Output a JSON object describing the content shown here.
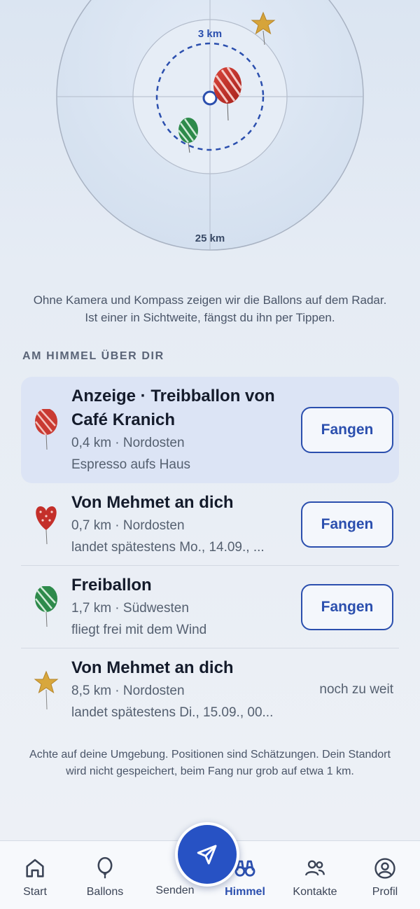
{
  "radar": {
    "inner_label": "3 km",
    "outer_label": "25 km"
  },
  "intro_text": "Ohne Kamera und Kompass zeigen wir die Ballons auf dem Radar. Ist einer in Sichtweite, fängst du ihn per Tippen.",
  "section_title": "AM HIMMEL ÜBER DIR",
  "balloons": [
    {
      "title": "Anzeige · Treibballon von Café Kranich",
      "meta": "0,4 km · Nordosten",
      "sub": "Espresso aufs Haus",
      "action": "Fangen",
      "icon": "red-striped-balloon-icon",
      "highlight": true
    },
    {
      "title": "Von Mehmet an dich",
      "meta": "0,7 km · Nordosten",
      "sub": "landet spätestens Mo., 14.09., ...",
      "action": "Fangen",
      "icon": "red-heart-balloon-icon"
    },
    {
      "title": "Freiballon",
      "meta": "1,7 km · Südwesten",
      "sub": "fliegt frei mit dem Wind",
      "action": "Fangen",
      "icon": "green-striped-balloon-icon"
    },
    {
      "title": "Von Mehmet an dich",
      "meta": "8,5 km · Nordosten",
      "sub": "landet spätestens Di., 15.09., 00...",
      "status": "noch zu weit",
      "icon": "gold-star-balloon-icon"
    }
  ],
  "footnote": "Achte auf deine Umgebung. Positionen sind Schätzungen. Dein Standort wird nicht gespeichert, beim Fang nur grob auf etwa 1 km.",
  "nav": [
    {
      "label": "Start",
      "icon": "home-icon"
    },
    {
      "label": "Ballons",
      "icon": "balloon-icon"
    },
    {
      "label": "Senden",
      "icon": "send-icon"
    },
    {
      "label": "Himmel",
      "icon": "binoculars-icon",
      "active": true
    },
    {
      "label": "Kontakte",
      "icon": "contacts-icon"
    },
    {
      "label": "Profil",
      "icon": "profile-icon"
    }
  ],
  "colors": {
    "accent": "#2752c4",
    "text": "#141b2b",
    "muted": "#556070",
    "highlight_bg": "#dce4f5"
  }
}
